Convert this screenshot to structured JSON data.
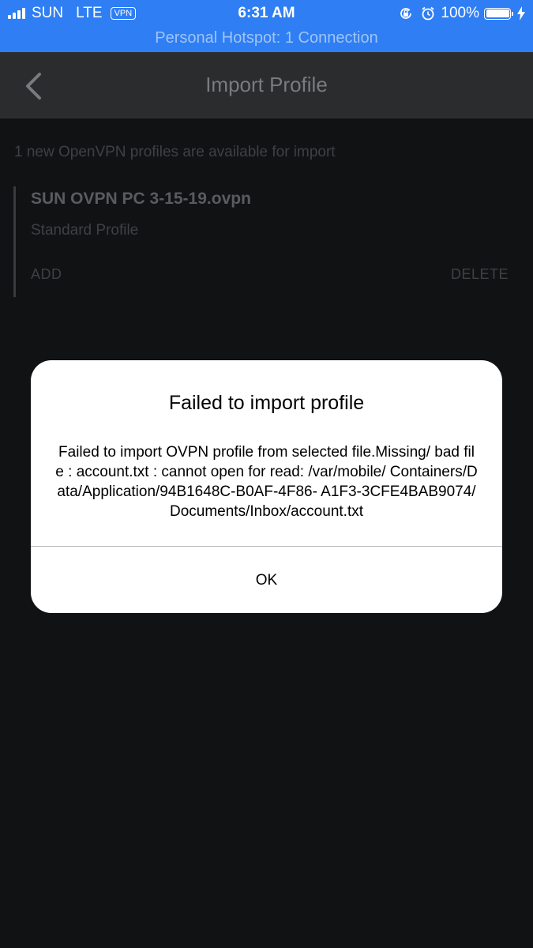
{
  "status_bar": {
    "carrier": "SUN",
    "network": "LTE",
    "vpn": "VPN",
    "time": "6:31 AM",
    "battery_percent": "100%",
    "battery_level": 1.0,
    "signal_bars": 4,
    "icons": [
      "orientation-lock-icon",
      "alarm-icon",
      "charging-bolt-icon"
    ]
  },
  "hotspot_banner": "Personal Hotspot: 1 Connection",
  "nav": {
    "back_icon": "chevron-left-icon",
    "title": "Import Profile"
  },
  "content": {
    "info": "1 new OpenVPN profiles are available for import",
    "profile": {
      "name": "SUN OVPN PC 3-15-19.ovpn",
      "type": "Standard Profile",
      "add_label": "ADD",
      "delete_label": "DELETE"
    }
  },
  "alert": {
    "title": "Failed to import profile",
    "message": "Failed to import OVPN profile from selected file.Missing/ bad file : account.txt : cannot open for read: /var/mobile/ Containers/Data/Application/94B1648C-B0AF-4F86- A1F3-3CFE4BAB9074/Documents/Inbox/account.txt",
    "ok_label": "OK"
  }
}
